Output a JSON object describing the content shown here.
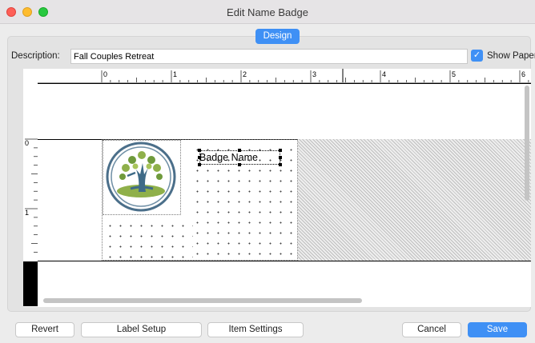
{
  "window": {
    "title": "Edit Name Badge"
  },
  "tabs": {
    "design_label": "Design"
  },
  "description": {
    "label": "Description:",
    "value": "Fall Couples Retreat"
  },
  "show_paper": {
    "label": "Show Paper",
    "checked": true
  },
  "rulers": {
    "top_labels": [
      "0",
      "1",
      "2",
      "3",
      "4",
      "5",
      "6"
    ],
    "left_labels": [
      "0",
      "1"
    ]
  },
  "canvas": {
    "name_field_text": "Badge Name",
    "logo_icon": "tree-logo-icon"
  },
  "buttons": {
    "revert": "Revert",
    "label_setup": "Label Setup",
    "item_settings": "Item Settings",
    "cancel": "Cancel",
    "save": "Save"
  },
  "colors": {
    "accent": "#3f90f5",
    "tree_trunk": "#3e6a87",
    "leaves": "#8fb04a"
  }
}
